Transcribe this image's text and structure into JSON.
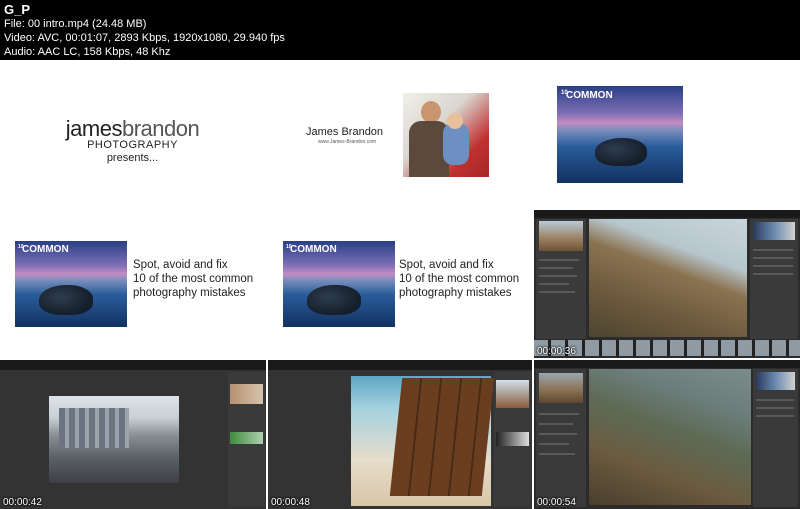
{
  "header": {
    "title": "G_P",
    "file": "File: 00 intro.mp4 (24.48 MB)",
    "video": "Video: AVC, 00:01:07, 2893 Kbps, 1920x1080, 29.940 fps",
    "audio": "Audio: AAC LC, 158 Kbps, 48 Khz"
  },
  "frames": {
    "f1": {
      "brand_first": "james",
      "brand_second": "brandon",
      "brand_sub": "PHOTOGRAPHY",
      "presents": "presents..."
    },
    "f2": {
      "name": "James Brandon",
      "site": "www.James-Brandon.com"
    },
    "f4": {
      "cover_title": "COMMON",
      "cover_prefix": "10"
    },
    "f5": {
      "line1": "Spot, avoid and fix",
      "line2": "10 of the most common",
      "line3": "photography mistakes",
      "cover_title": "COMMON",
      "cover_prefix": "10"
    },
    "f6": {
      "line1": "Spot, avoid and fix",
      "line2": "10 of the most common",
      "line3": "photography mistakes",
      "cover_title": "COMMON",
      "cover_prefix": "10"
    },
    "f7": {
      "time": "00:00:36"
    },
    "f8": {
      "time": "00:00:42"
    },
    "f9": {
      "time": "00:00:48"
    },
    "f10": {
      "time": "00:00:54"
    }
  }
}
